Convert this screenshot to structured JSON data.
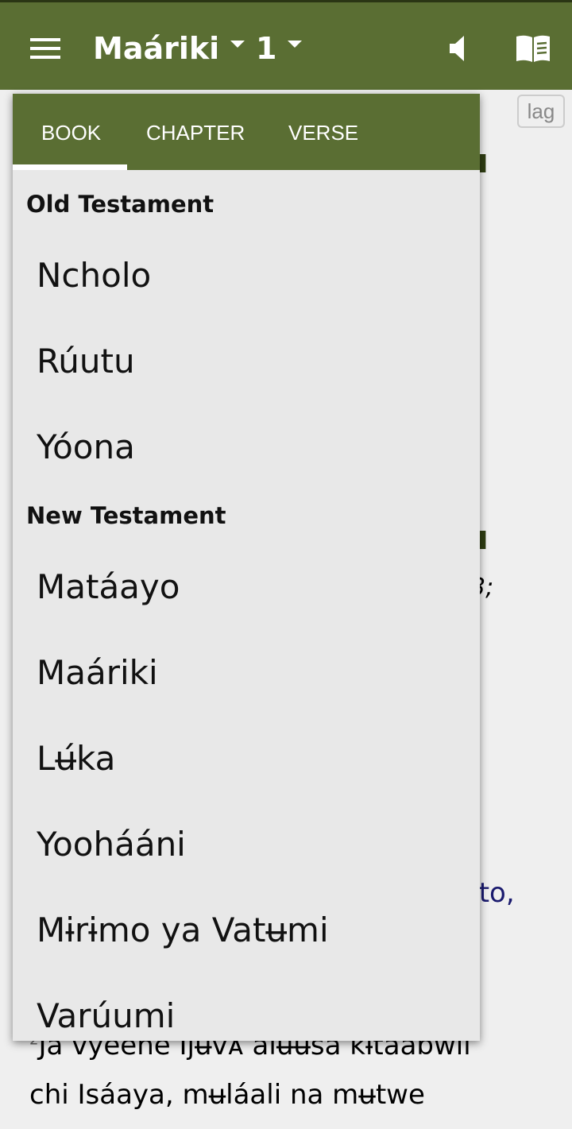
{
  "appbar": {
    "book": "Maáriki",
    "chapter": "1"
  },
  "background": {
    "lag_label": "lag",
    "heading_fragment_1": "u",
    "heading_fragment_2": "u",
    "text_fragment_1": "3;",
    "text_fragment_2": "sto,",
    "verse_number": "2",
    "verse_line_1": "Ja vyeene Iȷʉᴠᴀ alʉʉsa kɨtaabwii",
    "verse_line_2": "chi Isáaya, mʉláali na mʉtwe"
  },
  "dropdown": {
    "tabs": [
      {
        "label": "BOOK",
        "active": true
      },
      {
        "label": "CHAPTER"
      },
      {
        "label": "VERSE"
      }
    ],
    "old_testament": {
      "label": "Old Testament",
      "books": [
        "Ncholo",
        "Rúutu",
        "Yóona"
      ]
    },
    "new_testament": {
      "label": "New Testament",
      "books": [
        "Matáayo",
        "Maáriki",
        "Lʉ́ka",
        "Yoohááni",
        "Mɨrɨmo ya Vatʉmi",
        "Varúumi"
      ]
    }
  },
  "colors": {
    "appbar": "#5a6e33",
    "heading": "#2f3d12",
    "link": "#1a1a6e"
  }
}
